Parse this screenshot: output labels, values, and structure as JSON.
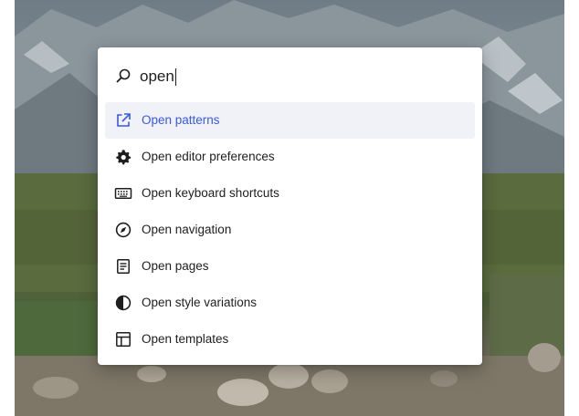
{
  "colors": {
    "accent": "#3858e9",
    "text": "#1e1e1e",
    "active_row_bg": "#f0f2f7",
    "panel_bg": "#ffffff"
  },
  "search": {
    "icon": "search-icon",
    "value": "open"
  },
  "results": [
    {
      "label": "Open patterns",
      "icon": "external-link-icon",
      "active": true
    },
    {
      "label": "Open editor preferences",
      "icon": "gear-icon",
      "active": false
    },
    {
      "label": "Open keyboard shortcuts",
      "icon": "keyboard-icon",
      "active": false
    },
    {
      "label": "Open navigation",
      "icon": "compass-icon",
      "active": false
    },
    {
      "label": "Open pages",
      "icon": "page-icon",
      "active": false
    },
    {
      "label": "Open style variations",
      "icon": "contrast-icon",
      "active": false
    },
    {
      "label": "Open templates",
      "icon": "layout-icon",
      "active": false
    }
  ]
}
